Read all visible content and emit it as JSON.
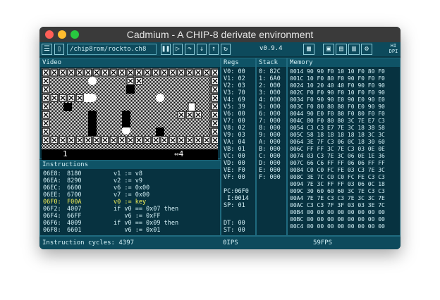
{
  "window": {
    "title": "Cadmium - A CHIP-8 derivate environment"
  },
  "toolbar": {
    "menu_icon": "hamburger-icon",
    "file_icon": "file-icon",
    "rom_path": "/chip8rom/rockto.ch8",
    "pause_icon": "pause-icon",
    "play_icon": "play-icon",
    "step_over_icon": "step-over-icon",
    "step_into_icon": "step-into-icon",
    "step_out_icon": "step-out-icon",
    "restart_icon": "restart-icon",
    "version": "v0.9.4",
    "hidpi_label": "HI DPI"
  },
  "video": {
    "header": "Video",
    "lives": "1",
    "score": "⇔4"
  },
  "instructions": {
    "header": "Instructions",
    "rows": [
      {
        "addr": "06E8:",
        "op": "8180",
        "asm": "v1 := v8",
        "hl": false
      },
      {
        "addr": "06EA:",
        "op": "8290",
        "asm": "v2 := v9",
        "hl": false
      },
      {
        "addr": "06EC:",
        "op": "6600",
        "asm": "v6 := 0x00",
        "hl": false
      },
      {
        "addr": "06EE:",
        "op": "6700",
        "asm": "v7 := 0x00",
        "hl": false
      },
      {
        "addr": "06F0:",
        "op": "F00A",
        "asm": "v0 := key",
        "hl": true
      },
      {
        "addr": "06F2:",
        "op": "4007",
        "asm": "if v0 == 0x07 then",
        "hl": false
      },
      {
        "addr": "06F4:",
        "op": "66FF",
        "asm": "   v6 := 0xFF",
        "hl": false
      },
      {
        "addr": "06F6:",
        "op": "4009",
        "asm": "if v0 == 0x09 then",
        "hl": false
      },
      {
        "addr": "06F8:",
        "op": "6601",
        "asm": "   v6 := 0x01",
        "hl": false
      }
    ]
  },
  "regs": {
    "header": "Regs",
    "values": [
      "V0: 00",
      "V1: 02",
      "V2: 03",
      "V3: 70",
      "V4: 69",
      "V5: 39",
      "V6: 00",
      "V7: 00",
      "V8: 02",
      "V9: 03",
      "VA: 04",
      "VB: 01",
      "VC: 00",
      "VD: 00",
      "VE: F0",
      "VF: 00"
    ],
    "pc": "PC:06F0",
    "i": " I:0014",
    "sp": "SP: 01",
    "dt": "DT: 00",
    "st": "ST: 00"
  },
  "stack": {
    "header": "Stack",
    "values": [
      "0: 82C",
      "1: 6A0",
      "2: 000",
      "3: 000",
      "4: 000",
      "5: 000",
      "6: 000",
      "7: 000",
      "8: 000",
      "9: 000",
      "A: 000",
      "B: 000",
      "C: 000",
      "D: 000",
      "E: 000",
      "F: 000"
    ]
  },
  "memory": {
    "header": "Memory",
    "rows": [
      "0014 90 90 F0 10 10 F0 80 F0",
      "001C 10 F0 80 F0 90 F0 F0 F0",
      "0024 10 20 40 40 F0 90 F0 90",
      "002C F0 F0 90 F0 10 F0 F0 90",
      "0034 F0 90 90 E0 90 E0 90 E0",
      "003C F0 80 80 80 F0 E0 90 90",
      "0044 90 E0 F0 80 F0 80 F0 F0",
      "004C 80 F0 80 80 3C 7E E7 C3",
      "0054 C3 C3 E7 7E 3C 18 38 58",
      "005C 58 18 18 18 18 18 3C 3C",
      "0064 3E 7F C3 06 0C 18 30 60",
      "006C FF FF 3C 7E C3 03 0E 0E",
      "0074 03 C3 7E 3C 06 0E 1E 36",
      "007C 66 C6 FF FF 06 06 FF FF",
      "0084 C0 C0 FC FE 03 C3 7E 3C",
      "008C 3E 7C C0 C0 FC FE C3 C3",
      "0094 7E 3C FF FF 03 06 0C 18",
      "009C 30 60 60 60 3C 7E C3 C3",
      "00A4 7E 7E C3 C3 7E 3C 3C 7E",
      "00AC C3 C3 7F 3F 03 03 3E 7C",
      "00B4 00 00 00 00 00 00 00 00",
      "00BC 00 00 00 00 00 00 00 00",
      "00C4 00 00 00 00 00 00 00 00"
    ]
  },
  "status": {
    "cycles": "Instruction cycles: 4397",
    "ips": "0IPS",
    "fps": "59FPS"
  }
}
